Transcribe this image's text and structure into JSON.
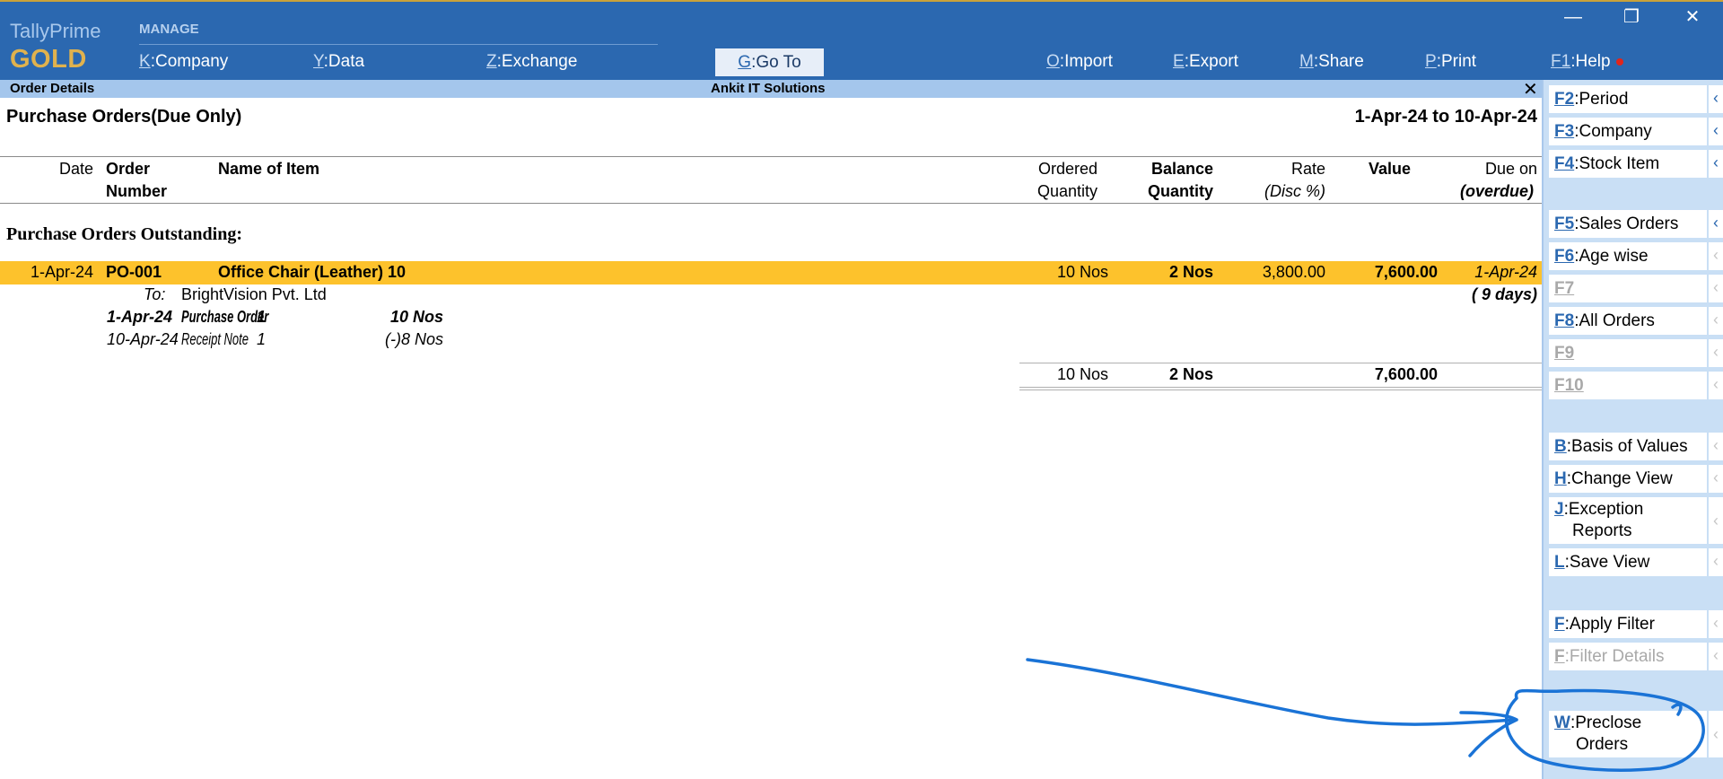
{
  "app": {
    "name": "TallyPrime",
    "edition": "GOLD",
    "manage_label": "MANAGE",
    "menu": [
      {
        "key": "K",
        "label": "Company"
      },
      {
        "key": "Y",
        "label": "Data"
      },
      {
        "key": "Z",
        "label": "Exchange"
      },
      {
        "key": "G",
        "label": "Go To"
      },
      {
        "key": "O",
        "label": "Import"
      },
      {
        "key": "E",
        "label": "Export"
      },
      {
        "key": "M",
        "label": "Share"
      },
      {
        "key": "P",
        "label": "Print"
      },
      {
        "key": "F1",
        "label": "Help"
      }
    ],
    "window_controls": {
      "minimize": "—",
      "restore": "❐",
      "close": "✕"
    }
  },
  "titlebar": {
    "screen": "Order Details",
    "company": "Ankit IT Solutions",
    "close": "✕"
  },
  "report": {
    "title": "Purchase Orders(Due Only)",
    "period": "1-Apr-24 to 10-Apr-24",
    "columns": {
      "date": "Date",
      "order_number_1": "Order",
      "order_number_2": "Number",
      "item": "Name of Item",
      "ordered_qty_1": "Ordered",
      "ordered_qty_2": "Quantity",
      "balance_qty_1": "Balance",
      "balance_qty_2": "Quantity",
      "rate_1": "Rate",
      "rate_2": "(Disc %)",
      "value": "Value",
      "due_on_1": "Due on",
      "due_on_2": "(overdue)"
    },
    "section_title": "Purchase Orders Outstanding:",
    "row": {
      "date": "1-Apr-24",
      "order_number": "PO-001",
      "item": "Office Chair (Leather) 10",
      "ordered_qty": "10 Nos",
      "balance_qty": "2 Nos",
      "rate": "3,800.00",
      "value": "7,600.00",
      "due_on": "1-Apr-24",
      "overdue": "( 9 days)",
      "party_prefix": "To:",
      "party": "BrightVision Pvt. Ltd",
      "details": [
        {
          "date": "1-Apr-24",
          "voucher_type": "Purchase Order",
          "voucher_no": "1",
          "qty": "10 Nos"
        },
        {
          "date": "10-Apr-24",
          "voucher_type": "Receipt Note",
          "voucher_no": "1",
          "qty": "(-)8 Nos"
        }
      ]
    },
    "totals": {
      "ordered_qty": "10 Nos",
      "balance_qty": "2 Nos",
      "value": "7,600.00"
    }
  },
  "sidepanel": {
    "buttons": [
      {
        "key": "F2",
        "label": "Period",
        "enabled": true
      },
      {
        "key": "F3",
        "label": "Company",
        "enabled": true
      },
      {
        "key": "F4",
        "label": "Stock Item",
        "enabled": true
      },
      {
        "key": "F5",
        "label": "Sales Orders",
        "enabled": true
      },
      {
        "key": "F6",
        "label": "Age wise",
        "enabled": true
      },
      {
        "key": "F7",
        "label": "",
        "enabled": false
      },
      {
        "key": "F8",
        "label": "All Orders",
        "enabled": true
      },
      {
        "key": "F9",
        "label": "",
        "enabled": false
      },
      {
        "key": "F10",
        "label": "",
        "enabled": false
      },
      {
        "key": "B",
        "label": "Basis of Values",
        "enabled": true
      },
      {
        "key": "H",
        "label": "Change View",
        "enabled": true
      },
      {
        "key": "J",
        "label": "Exception",
        "label2": "Reports",
        "enabled": true
      },
      {
        "key": "L",
        "label": "Save View",
        "enabled": true
      },
      {
        "key": "F",
        "label": "Apply Filter",
        "enabled": true
      },
      {
        "key": "F",
        "label": "Filter Details",
        "enabled": false
      },
      {
        "key": "W",
        "label": "Preclose",
        "label2": "Orders",
        "enabled": true
      }
    ],
    "chevron": "‹"
  },
  "colors": {
    "topbar": "#2b68b0",
    "titlebar": "#a4c6ec",
    "highlight_row": "#fdc22c",
    "sidepanel": "#c9dff5",
    "annotation_ink": "#1a73d6",
    "brand_gold": "#e0b24e"
  }
}
